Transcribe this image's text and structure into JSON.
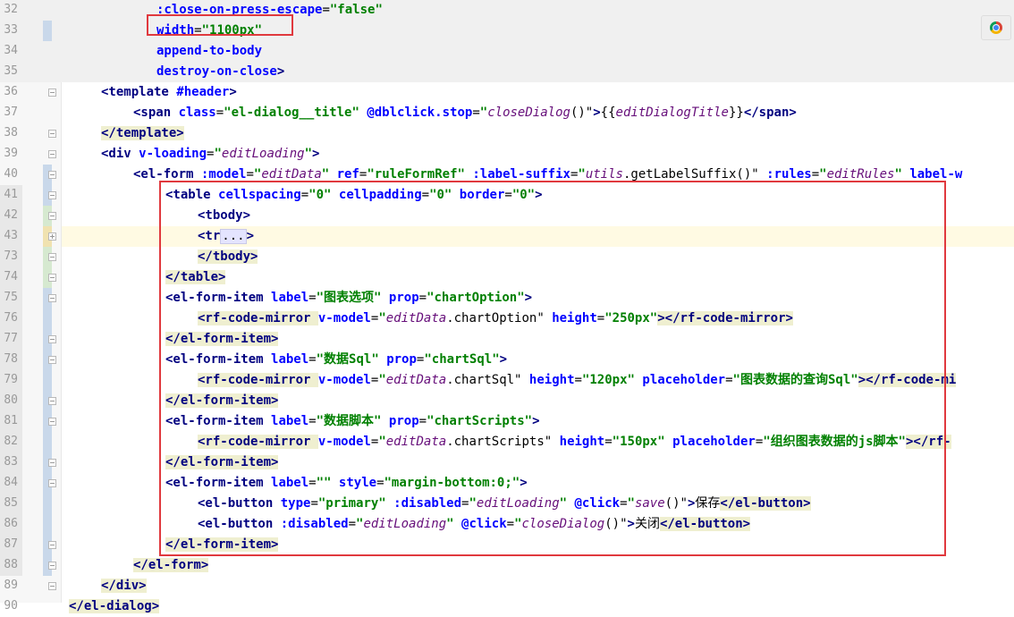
{
  "lines": [
    {
      "n": "32",
      "parts": [
        {
          "t": ":close-on-press-escape",
          "c": "attr"
        },
        {
          "t": "=",
          "c": "txt"
        },
        {
          "t": "\"false\"",
          "c": "val"
        }
      ]
    },
    {
      "n": "33",
      "parts": [
        {
          "t": "width",
          "c": "attr"
        },
        {
          "t": "=",
          "c": "txt"
        },
        {
          "t": "\"1100px\"",
          "c": "val"
        }
      ]
    },
    {
      "n": "34",
      "parts": [
        {
          "t": "append-to-body",
          "c": "attr"
        }
      ]
    },
    {
      "n": "35",
      "parts": [
        {
          "t": "destroy-on-close",
          "c": "attr"
        },
        {
          "t": ">",
          "c": "tag"
        }
      ]
    },
    {
      "n": "36",
      "parts": [
        {
          "t": "<template ",
          "c": "tag"
        },
        {
          "t": "#header",
          "c": "attr"
        },
        {
          "t": ">",
          "c": "tag"
        }
      ]
    },
    {
      "n": "37",
      "parts": [
        {
          "t": "<span ",
          "c": "tag"
        },
        {
          "t": "class",
          "c": "attr"
        },
        {
          "t": "=",
          "c": "txt"
        },
        {
          "t": "\"el-dialog__title\"",
          "c": "val"
        },
        {
          "t": " ",
          "c": "txt"
        },
        {
          "t": "@dblclick.stop",
          "c": "attr"
        },
        {
          "t": "=",
          "c": "txt"
        },
        {
          "t": "\"",
          "c": "val"
        },
        {
          "t": "closeDialog",
          "c": "ital"
        },
        {
          "t": "()\"",
          "c": "txt"
        },
        {
          "t": ">",
          "c": "tag"
        },
        {
          "t": "{{",
          "c": "txt"
        },
        {
          "t": "editDialogTitle",
          "c": "ital"
        },
        {
          "t": "}}",
          "c": "txt"
        },
        {
          "t": "</span>",
          "c": "tag"
        }
      ]
    },
    {
      "n": "38",
      "parts": [
        {
          "t": "</template>",
          "c": "tag"
        }
      ]
    },
    {
      "n": "39",
      "parts": [
        {
          "t": "<div ",
          "c": "tag"
        },
        {
          "t": "v-loading",
          "c": "attr"
        },
        {
          "t": "=",
          "c": "txt"
        },
        {
          "t": "\"",
          "c": "val"
        },
        {
          "t": "editLoading",
          "c": "ital"
        },
        {
          "t": "\"",
          "c": "val"
        },
        {
          "t": ">",
          "c": "tag"
        }
      ]
    },
    {
      "n": "40",
      "parts": [
        {
          "t": "<el-form ",
          "c": "tag"
        },
        {
          "t": ":model",
          "c": "attr"
        },
        {
          "t": "=",
          "c": "txt"
        },
        {
          "t": "\"",
          "c": "val"
        },
        {
          "t": "editData",
          "c": "ital"
        },
        {
          "t": "\"",
          "c": "val"
        },
        {
          "t": " ",
          "c": "txt"
        },
        {
          "t": "ref",
          "c": "attr"
        },
        {
          "t": "=",
          "c": "txt"
        },
        {
          "t": "\"ruleFormRef\"",
          "c": "val"
        },
        {
          "t": " ",
          "c": "txt"
        },
        {
          "t": ":label-suffix",
          "c": "attr"
        },
        {
          "t": "=",
          "c": "txt"
        },
        {
          "t": "\"",
          "c": "val"
        },
        {
          "t": "utils",
          "c": "ital"
        },
        {
          "t": ".getLabelSuffix()\"",
          "c": "txt"
        },
        {
          "t": " ",
          "c": "txt"
        },
        {
          "t": ":rules",
          "c": "attr"
        },
        {
          "t": "=",
          "c": "txt"
        },
        {
          "t": "\"",
          "c": "val"
        },
        {
          "t": "editRules",
          "c": "ital"
        },
        {
          "t": "\"",
          "c": "val"
        },
        {
          "t": " ",
          "c": "txt"
        },
        {
          "t": "label-w",
          "c": "attr"
        }
      ]
    },
    {
      "n": "41",
      "parts": [
        {
          "t": "<table ",
          "c": "tag"
        },
        {
          "t": "cellspacing",
          "c": "attr"
        },
        {
          "t": "=",
          "c": "txt"
        },
        {
          "t": "\"0\"",
          "c": "val"
        },
        {
          "t": " ",
          "c": "txt"
        },
        {
          "t": "cellpadding",
          "c": "attr"
        },
        {
          "t": "=",
          "c": "txt"
        },
        {
          "t": "\"0\"",
          "c": "val"
        },
        {
          "t": " ",
          "c": "txt"
        },
        {
          "t": "border",
          "c": "attr"
        },
        {
          "t": "=",
          "c": "txt"
        },
        {
          "t": "\"0\"",
          "c": "val"
        },
        {
          "t": ">",
          "c": "tag"
        }
      ]
    },
    {
      "n": "42",
      "parts": [
        {
          "t": "<tbody>",
          "c": "tag"
        }
      ]
    },
    {
      "n": "43",
      "parts": [
        {
          "t": "<tr",
          "c": "tag"
        },
        {
          "t": "...",
          "c": "fold"
        },
        {
          "t": ">",
          "c": "tag"
        }
      ]
    },
    {
      "n": "73",
      "parts": [
        {
          "t": "</tbody>",
          "c": "tag"
        }
      ]
    },
    {
      "n": "74",
      "parts": [
        {
          "t": "</table>",
          "c": "tag"
        }
      ]
    },
    {
      "n": "75",
      "parts": [
        {
          "t": "<el-form-item ",
          "c": "tag"
        },
        {
          "t": "label",
          "c": "attr"
        },
        {
          "t": "=",
          "c": "txt"
        },
        {
          "t": "\"图表选项\"",
          "c": "val"
        },
        {
          "t": " ",
          "c": "txt"
        },
        {
          "t": "prop",
          "c": "attr"
        },
        {
          "t": "=",
          "c": "txt"
        },
        {
          "t": "\"chartOption\"",
          "c": "val"
        },
        {
          "t": ">",
          "c": "tag"
        }
      ]
    },
    {
      "n": "76",
      "parts": [
        {
          "t": "<rf-code-mirror ",
          "c": "tag"
        },
        {
          "t": "v-model",
          "c": "attr"
        },
        {
          "t": "=",
          "c": "txt"
        },
        {
          "t": "\"",
          "c": "val"
        },
        {
          "t": "editData",
          "c": "ital"
        },
        {
          "t": ".chartOption\"",
          "c": "txt"
        },
        {
          "t": " ",
          "c": "txt"
        },
        {
          "t": "height",
          "c": "attr"
        },
        {
          "t": "=",
          "c": "txt"
        },
        {
          "t": "\"250px\"",
          "c": "val"
        },
        {
          "t": "></rf-code-mirror>",
          "c": "tag"
        }
      ]
    },
    {
      "n": "77",
      "parts": [
        {
          "t": "</el-form-item>",
          "c": "tag"
        }
      ]
    },
    {
      "n": "78",
      "parts": [
        {
          "t": "<el-form-item ",
          "c": "tag"
        },
        {
          "t": "label",
          "c": "attr"
        },
        {
          "t": "=",
          "c": "txt"
        },
        {
          "t": "\"数据Sql\"",
          "c": "val"
        },
        {
          "t": " ",
          "c": "txt"
        },
        {
          "t": "prop",
          "c": "attr"
        },
        {
          "t": "=",
          "c": "txt"
        },
        {
          "t": "\"chartSql\"",
          "c": "val"
        },
        {
          "t": ">",
          "c": "tag"
        }
      ]
    },
    {
      "n": "79",
      "parts": [
        {
          "t": "<rf-code-mirror ",
          "c": "tag"
        },
        {
          "t": "v-model",
          "c": "attr"
        },
        {
          "t": "=",
          "c": "txt"
        },
        {
          "t": "\"",
          "c": "val"
        },
        {
          "t": "editData",
          "c": "ital"
        },
        {
          "t": ".chartSql\"",
          "c": "txt"
        },
        {
          "t": " ",
          "c": "txt"
        },
        {
          "t": "height",
          "c": "attr"
        },
        {
          "t": "=",
          "c": "txt"
        },
        {
          "t": "\"120px\"",
          "c": "val"
        },
        {
          "t": " ",
          "c": "txt"
        },
        {
          "t": "placeholder",
          "c": "attr"
        },
        {
          "t": "=",
          "c": "txt"
        },
        {
          "t": "\"图表数据的查询Sql\"",
          "c": "val"
        },
        {
          "t": "></rf-code-mi",
          "c": "tag"
        }
      ]
    },
    {
      "n": "80",
      "parts": [
        {
          "t": "</el-form-item>",
          "c": "tag"
        }
      ]
    },
    {
      "n": "81",
      "parts": [
        {
          "t": "<el-form-item ",
          "c": "tag"
        },
        {
          "t": "label",
          "c": "attr"
        },
        {
          "t": "=",
          "c": "txt"
        },
        {
          "t": "\"数据脚本\"",
          "c": "val"
        },
        {
          "t": " ",
          "c": "txt"
        },
        {
          "t": "prop",
          "c": "attr"
        },
        {
          "t": "=",
          "c": "txt"
        },
        {
          "t": "\"chartScripts\"",
          "c": "val"
        },
        {
          "t": ">",
          "c": "tag"
        }
      ]
    },
    {
      "n": "82",
      "parts": [
        {
          "t": "<rf-code-mirror ",
          "c": "tag"
        },
        {
          "t": "v-model",
          "c": "attr"
        },
        {
          "t": "=",
          "c": "txt"
        },
        {
          "t": "\"",
          "c": "val"
        },
        {
          "t": "editData",
          "c": "ital"
        },
        {
          "t": ".chartScripts\"",
          "c": "txt"
        },
        {
          "t": " ",
          "c": "txt"
        },
        {
          "t": "height",
          "c": "attr"
        },
        {
          "t": "=",
          "c": "txt"
        },
        {
          "t": "\"150px\"",
          "c": "val"
        },
        {
          "t": " ",
          "c": "txt"
        },
        {
          "t": "placeholder",
          "c": "attr"
        },
        {
          "t": "=",
          "c": "txt"
        },
        {
          "t": "\"组织图表数据的js脚本\"",
          "c": "val"
        },
        {
          "t": "></rf-",
          "c": "tag"
        }
      ]
    },
    {
      "n": "83",
      "parts": [
        {
          "t": "</el-form-item>",
          "c": "tag"
        }
      ]
    },
    {
      "n": "84",
      "parts": [
        {
          "t": "<el-form-item ",
          "c": "tag"
        },
        {
          "t": "label",
          "c": "attr"
        },
        {
          "t": "=",
          "c": "txt"
        },
        {
          "t": "\"\"",
          "c": "val"
        },
        {
          "t": " ",
          "c": "txt"
        },
        {
          "t": "style",
          "c": "attr"
        },
        {
          "t": "=",
          "c": "txt"
        },
        {
          "t": "\"margin-bottom:0;\"",
          "c": "val"
        },
        {
          "t": ">",
          "c": "tag"
        }
      ]
    },
    {
      "n": "85",
      "parts": [
        {
          "t": "<el-button ",
          "c": "tag"
        },
        {
          "t": "type",
          "c": "attr"
        },
        {
          "t": "=",
          "c": "txt"
        },
        {
          "t": "\"primary\"",
          "c": "val"
        },
        {
          "t": " ",
          "c": "txt"
        },
        {
          "t": ":disabled",
          "c": "attr"
        },
        {
          "t": "=",
          "c": "txt"
        },
        {
          "t": "\"",
          "c": "val"
        },
        {
          "t": "editLoading",
          "c": "ital"
        },
        {
          "t": "\"",
          "c": "val"
        },
        {
          "t": " ",
          "c": "txt"
        },
        {
          "t": "@click",
          "c": "attr"
        },
        {
          "t": "=",
          "c": "txt"
        },
        {
          "t": "\"",
          "c": "val"
        },
        {
          "t": "save",
          "c": "ital"
        },
        {
          "t": "()\"",
          "c": "txt"
        },
        {
          "t": ">",
          "c": "tag"
        },
        {
          "t": "保存",
          "c": "txt"
        },
        {
          "t": "</el-button>",
          "c": "tag"
        }
      ]
    },
    {
      "n": "86",
      "parts": [
        {
          "t": "<el-button ",
          "c": "tag"
        },
        {
          "t": ":disabled",
          "c": "attr"
        },
        {
          "t": "=",
          "c": "txt"
        },
        {
          "t": "\"",
          "c": "val"
        },
        {
          "t": "editLoading",
          "c": "ital"
        },
        {
          "t": "\"",
          "c": "val"
        },
        {
          "t": " ",
          "c": "txt"
        },
        {
          "t": "@click",
          "c": "attr"
        },
        {
          "t": "=",
          "c": "txt"
        },
        {
          "t": "\"",
          "c": "val"
        },
        {
          "t": "closeDialog",
          "c": "ital"
        },
        {
          "t": "()\"",
          "c": "txt"
        },
        {
          "t": ">",
          "c": "tag"
        },
        {
          "t": "关闭",
          "c": "txt"
        },
        {
          "t": "</el-button>",
          "c": "tag"
        }
      ]
    },
    {
      "n": "87",
      "parts": [
        {
          "t": "</el-form-item>",
          "c": "tag"
        }
      ]
    },
    {
      "n": "88",
      "parts": [
        {
          "t": "</el-form>",
          "c": "tag"
        }
      ]
    },
    {
      "n": "89",
      "parts": [
        {
          "t": "</div>",
          "c": "tag"
        }
      ]
    },
    {
      "n": "90",
      "parts": [
        {
          "t": "</el-dialog>",
          "c": "tag"
        }
      ]
    }
  ],
  "browser_preview_icon": "chrome-icon"
}
